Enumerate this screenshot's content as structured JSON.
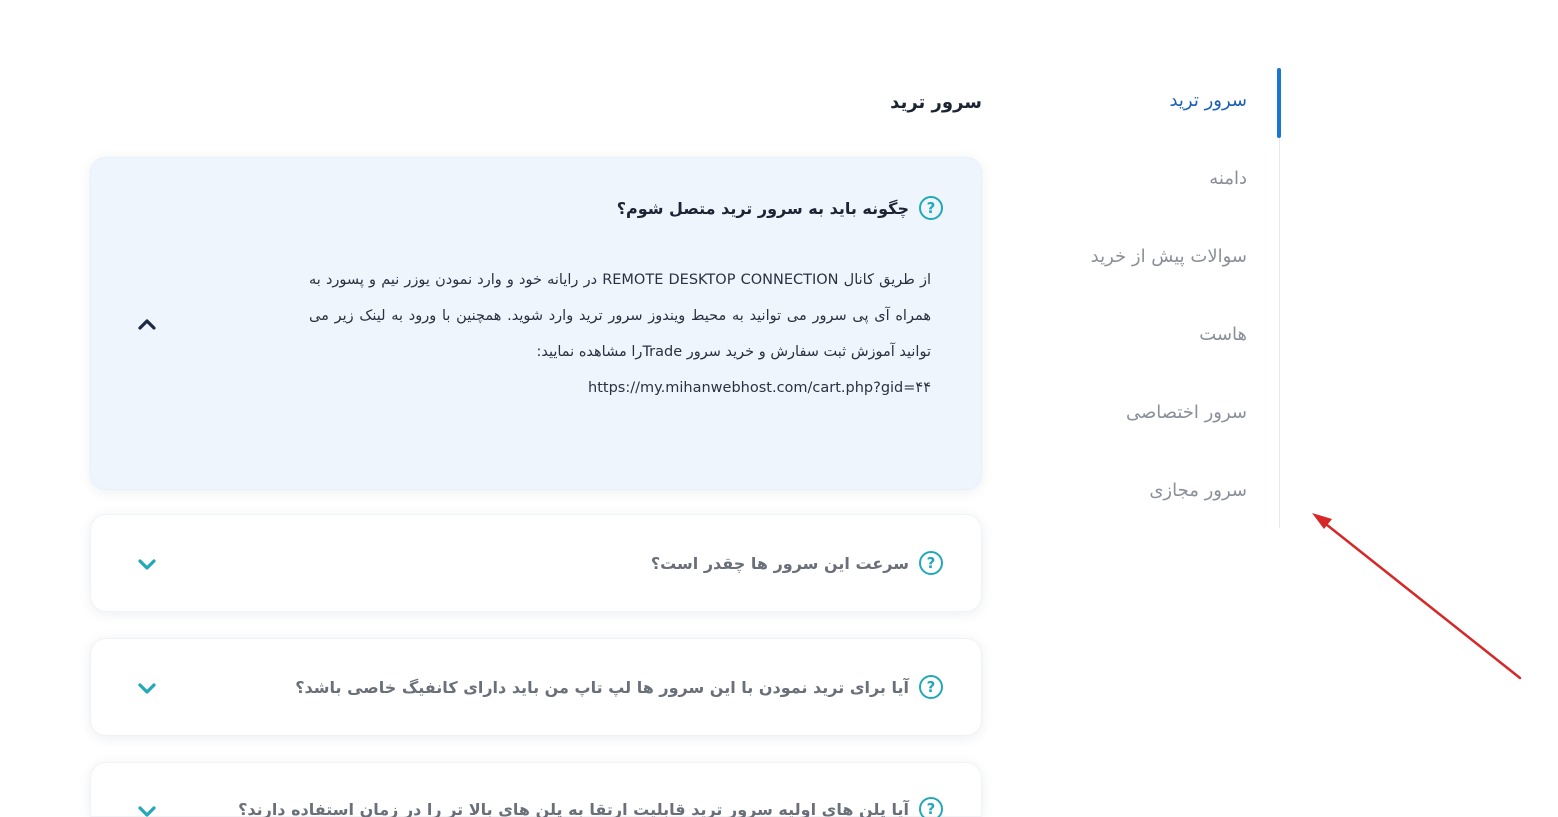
{
  "sidebar": {
    "items": [
      {
        "label": "سرور ترید",
        "active": true
      },
      {
        "label": "دامنه",
        "active": false
      },
      {
        "label": "سوالات پیش از خرید",
        "active": false
      },
      {
        "label": "هاست",
        "active": false
      },
      {
        "label": "سرور اختصاصی",
        "active": false
      },
      {
        "label": "سرور مجازی",
        "active": false
      }
    ]
  },
  "main": {
    "title": "سرور ترید",
    "faqs": [
      {
        "question": "چگونه باید به سرور ترید متصل شوم؟",
        "expanded": true,
        "answer": "از طریق کانال REMOTE DESKTOP CONNECTION در رایانه خود و وارد نمودن یوزر نیم و پسورد به همراه آی پی سرور می توانید به محیط ویندوز سرور ترید وارد شوید. همچنین با ورود به لینک زیر می توانید آموزش ثبت سفارش و خرید سرور Tradeرا مشاهده نمایید:",
        "link": "https://my.mihanwebhost.com/cart.php?gid=۴۴"
      },
      {
        "question": "سرعت این سرور ها چقدر است؟",
        "expanded": false
      },
      {
        "question": "آیا برای ترید نمودن با این سرور ها لپ تاپ من باید دارای کانفیگ خاصی باشد؟",
        "expanded": false
      },
      {
        "question": "آیا پلن های اولیه سرور ترید قابلیت ارتقا به پلن های بالا تر را در زمان استفاده دارند؟",
        "expanded": false
      }
    ],
    "icons": {
      "question": "?",
      "question_icon_name": "question-circle-icon",
      "expand_icon_name": "chevron-down-icon",
      "collapse_icon_name": "chevron-up-icon"
    }
  },
  "colors": {
    "accent": "#1976d2",
    "icon_teal": "#22a8b8",
    "open_card_bg": "#eef5fc",
    "annotation_arrow": "#d62828"
  }
}
